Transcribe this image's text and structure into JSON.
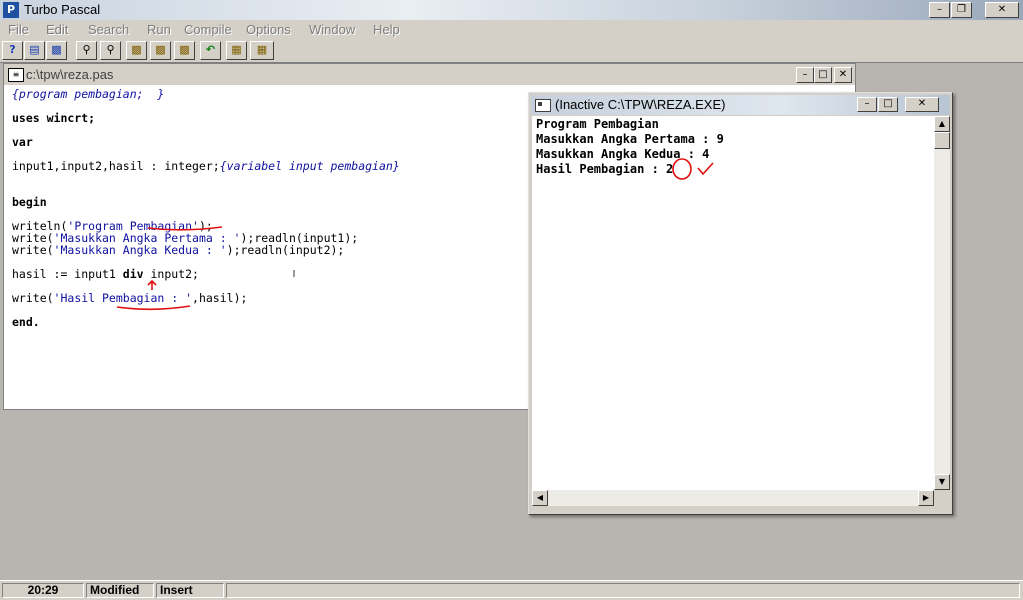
{
  "app": {
    "title": "Turbo Pascal",
    "icon": "pascal-app-icon",
    "caption_buttons": [
      "minimize",
      "restore",
      "close"
    ]
  },
  "menu": [
    "File",
    "Edit",
    "Search",
    "Run",
    "Compile",
    "Options",
    "Window",
    "Help"
  ],
  "toolbar": {
    "icons": [
      "help-icon",
      "open-file-icon",
      "save-file-icon",
      "find-icon",
      "find-next-icon",
      "compile-icon",
      "make-icon",
      "build-icon",
      "undo-icon",
      "run-icon",
      "step-icon"
    ]
  },
  "editor": {
    "path": "c:\\tpw\\reza.pas",
    "lines": {
      "l1": "{program pembagian;  }",
      "l2": "uses wincrt;",
      "l3": "var",
      "l4a": "input1,input2,hasil : integer;",
      "l4b": "{variabel input pembagian}",
      "l5": "begin",
      "l6a": "writeln(",
      "l6b": "'Program Pembagian'",
      "l6c": ");",
      "l7a": "write(",
      "l7b": "'Masukkan Angka Pertama : '",
      "l7c": ");readln(input1);",
      "l8a": "write(",
      "l8b": "'Masukkan Angka Kedua : '",
      "l8c": ");readln(input2);",
      "l9a": "hasil := input1 ",
      "l9b": "div",
      "l9c": " input2;",
      "l10a": "write(",
      "l10b": "'Hasil Pembagian : '",
      "l10c": ",hasil);",
      "l11": "end."
    }
  },
  "output_window": {
    "title": "(Inactive C:\\TPW\\REZA.EXE)",
    "lines": [
      "Program Pembagian",
      "Masukkan Angka Pertama : 9",
      "Masukkan Angka Kedua : 4",
      "Hasil Pembagian : 2"
    ]
  },
  "status": {
    "position": "20:29",
    "modified": "Modified",
    "mode": "Insert"
  },
  "colors": {
    "string_color": "#1010a0",
    "annotation_ink": "#e01010",
    "window_bg": "#d4d0c8"
  }
}
